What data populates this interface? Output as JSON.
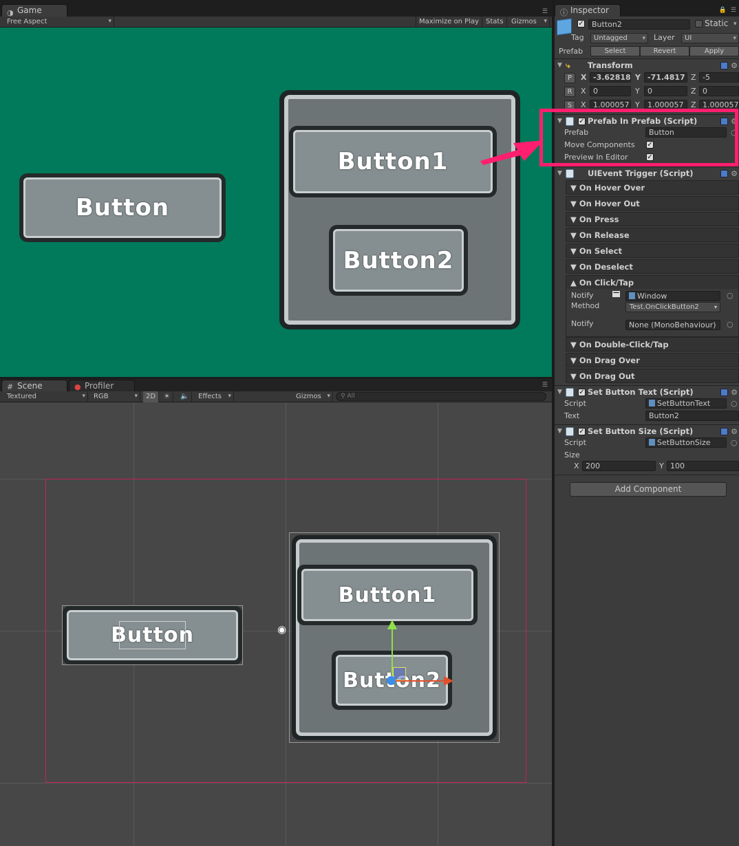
{
  "game_tab": {
    "label": "Game",
    "icon": "pacman-icon"
  },
  "game_toolbar": {
    "aspect": "Free Aspect",
    "maximize": "Maximize on Play",
    "stats": "Stats",
    "gizmos": "Gizmos"
  },
  "game_view": {
    "background": "#007a5a",
    "button_left": "Button",
    "button1": "Button1",
    "button2": "Button2"
  },
  "scene_tabs": {
    "scene": "Scene",
    "profiler": "Profiler"
  },
  "scene_toolbar": {
    "draw_mode": "Textured",
    "render_mode": "RGB",
    "mode_2d": "2D",
    "effects": "Effects",
    "gizmos": "Gizmos",
    "search_placeholder": "All"
  },
  "scene_view": {
    "button_left": "Button",
    "button1": "Button1",
    "button2": "Button2"
  },
  "inspector": {
    "tab_label": "Inspector",
    "object_name": "Button2",
    "static_label": "Static",
    "tag_label": "Tag",
    "tag_value": "Untagged",
    "layer_label": "Layer",
    "layer_value": "UI",
    "prefab_label": "Prefab",
    "prefab_select": "Select",
    "prefab_revert": "Revert",
    "prefab_apply": "Apply",
    "transform": {
      "title": "Transform",
      "p_btn": "P",
      "r_btn": "R",
      "s_btn": "S",
      "x": "X",
      "y": "Y",
      "z": "Z",
      "pos_x": "-3.62818",
      "pos_y": "-71.4817",
      "pos_z": "-5",
      "rot_x": "0",
      "rot_y": "0",
      "rot_z": "0",
      "scale_x": "1.000057",
      "scale_y": "1.000057",
      "scale_z": "1.000057"
    },
    "prefab_in_prefab": {
      "title": "Prefab In Prefab (Script)",
      "prefab_label": "Prefab",
      "prefab_value": "Button",
      "move_components": "Move Components",
      "preview_in_editor": "Preview In Editor"
    },
    "uievent": {
      "title": "UIEvent Trigger (Script)",
      "events": [
        "On Hover Over",
        "On Hover Out",
        "On Press",
        "On Release",
        "On Select",
        "On Deselect"
      ],
      "click_title": "On Click/Tap",
      "notify_label": "Notify",
      "notify_value": "Window",
      "method_label": "Method",
      "method_value": "Test.OnClickButton2",
      "notify2_label": "Notify",
      "notify2_value": "None (MonoBehaviour)",
      "events_after": [
        "On Double-Click/Tap",
        "On Drag Over",
        "On Drag Out"
      ]
    },
    "set_text": {
      "title": "Set Button Text (Script)",
      "script_label": "Script",
      "script_value": "SetButtonText",
      "text_label": "Text",
      "text_value": "Button2"
    },
    "set_size": {
      "title": "Set Button Size (Script)",
      "script_label": "Script",
      "script_value": "SetButtonSize",
      "size_label": "Size",
      "x_label": "X",
      "x_value": "200",
      "y_label": "Y",
      "y_value": "100"
    },
    "add_component": "Add Component"
  },
  "colors": {
    "highlight": "#ff1f6e",
    "canvas_rect": "#c8205a"
  }
}
